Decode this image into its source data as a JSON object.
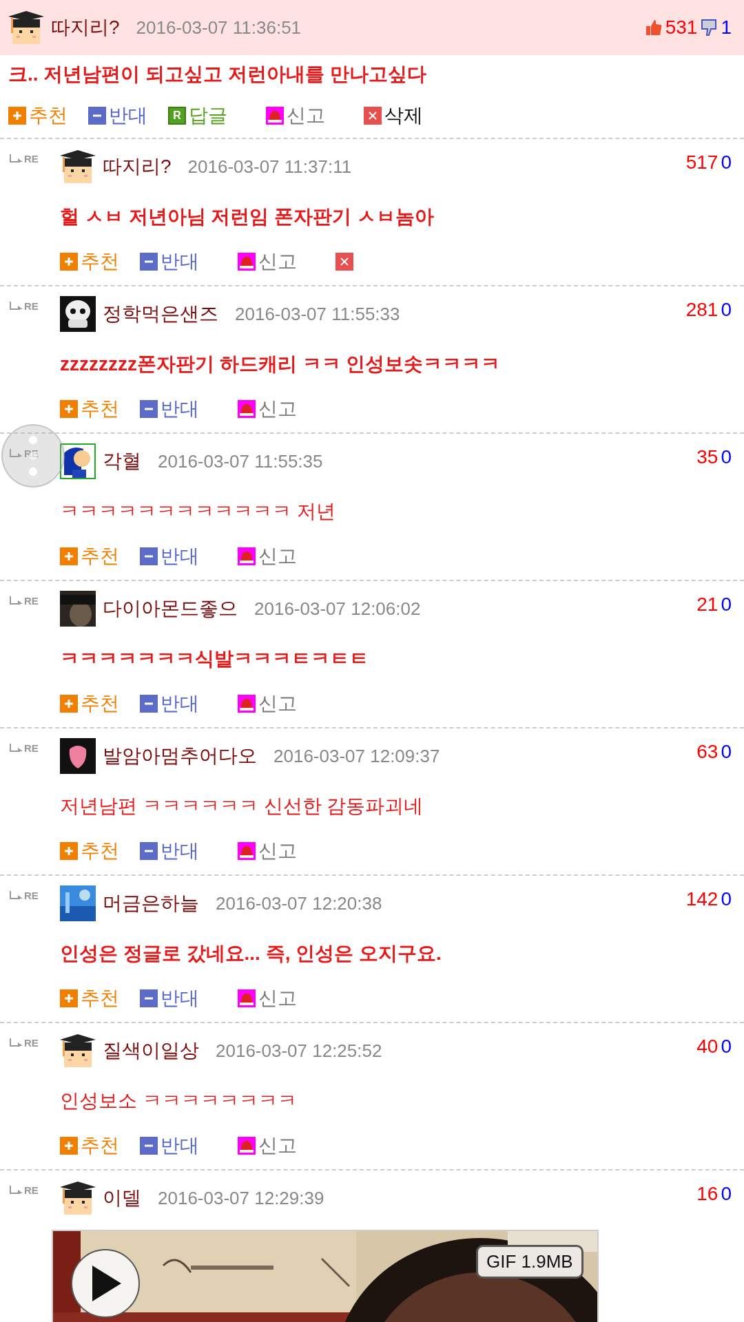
{
  "post": {
    "author": "따지리?",
    "time": "2016-03-07 11:36:51",
    "likes": "531",
    "dislikes": "1",
    "text": "크.. 저년남편이 되고싶고 저런아내를 만나고싶다",
    "bold": true,
    "avatar": {
      "kind": "graduate"
    },
    "actions": [
      {
        "kind": "recommend",
        "label": "추천"
      },
      {
        "kind": "oppose",
        "label": "반대"
      },
      {
        "kind": "reply",
        "icon": "R",
        "label": "답글"
      },
      {
        "kind": "report",
        "label": "신고"
      },
      {
        "kind": "delete",
        "label": "삭제"
      }
    ]
  },
  "replies": [
    {
      "tag": "RE",
      "author": "따지리?",
      "time": "2016-03-07 11:37:11",
      "likes": "517",
      "dislikes": "0",
      "text": "헐 ㅅㅂ 저년아님 저런임 폰자판기 ㅅㅂ놈아",
      "bold": true,
      "avatar": {
        "kind": "graduate"
      },
      "actions": [
        {
          "kind": "recommend",
          "label": "추천"
        },
        {
          "kind": "oppose",
          "label": "반대"
        },
        {
          "kind": "report",
          "label": "신고"
        },
        {
          "kind": "delete"
        }
      ]
    },
    {
      "tag": "RE",
      "author": "정학먹은샌즈",
      "time": "2016-03-07 11:55:33",
      "likes": "281",
      "dislikes": "0",
      "text": "zzzzzzzz폰자판기 하드캐리 ㅋㅋ 인성보솟ㅋㅋㅋㅋ",
      "bold": true,
      "avatar": {
        "kind": "skull"
      },
      "actions": [
        {
          "kind": "recommend",
          "label": "추천"
        },
        {
          "kind": "oppose",
          "label": "반대"
        },
        {
          "kind": "report",
          "label": "신고"
        }
      ]
    },
    {
      "tag": "RE",
      "author": "각혈",
      "time": "2016-03-07 11:55:35",
      "likes": "35",
      "dislikes": "0",
      "text": "ㅋㅋㅋㅋㅋㅋㅋㅋㅋㅋㅋㅋ 저년",
      "bold": false,
      "avatar": {
        "kind": "blue-figure"
      },
      "actions": [
        {
          "kind": "recommend",
          "label": "추천"
        },
        {
          "kind": "oppose",
          "label": "반대"
        },
        {
          "kind": "report",
          "label": "신고"
        }
      ]
    },
    {
      "tag": "RE",
      "author": "다이아몬드좋으",
      "time": "2016-03-07 12:06:02",
      "likes": "21",
      "dislikes": "0",
      "text": "ㅋㅋㅋㅋㅋㅋㅋ식발ㅋㅋㅋㅌㅋㅌㅌ",
      "bold": true,
      "avatar": {
        "kind": "dark"
      },
      "actions": [
        {
          "kind": "recommend",
          "label": "추천"
        },
        {
          "kind": "oppose",
          "label": "반대"
        },
        {
          "kind": "report",
          "label": "신고"
        }
      ]
    },
    {
      "tag": "RE",
      "author": "발암아멈추어다오",
      "time": "2016-03-07 12:09:37",
      "likes": "63",
      "dislikes": "0",
      "text": "저년남편 ㅋㅋㅋㅋㅋㅋ 신선한 감동파괴네",
      "bold": false,
      "avatar": {
        "kind": "pink"
      },
      "actions": [
        {
          "kind": "recommend",
          "label": "추천"
        },
        {
          "kind": "oppose",
          "label": "반대"
        },
        {
          "kind": "report",
          "label": "신고"
        }
      ]
    },
    {
      "tag": "RE",
      "author": "머금은하늘",
      "time": "2016-03-07 12:20:38",
      "likes": "142",
      "dislikes": "0",
      "text": "인성은 정글로 갔네요... 즉, 인성은 오지구요.",
      "bold": true,
      "avatar": {
        "kind": "sky"
      },
      "actions": [
        {
          "kind": "recommend",
          "label": "추천"
        },
        {
          "kind": "oppose",
          "label": "반대"
        },
        {
          "kind": "report",
          "label": "신고"
        }
      ]
    },
    {
      "tag": "RE",
      "author": "질색이일상",
      "time": "2016-03-07 12:25:52",
      "likes": "40",
      "dislikes": "0",
      "text": "인성보소 ㅋㅋㅋㅋㅋㅋㅋㅋ",
      "bold": false,
      "avatar": {
        "kind": "graduate"
      },
      "actions": [
        {
          "kind": "recommend",
          "label": "추천"
        },
        {
          "kind": "oppose",
          "label": "반대"
        },
        {
          "kind": "report",
          "label": "신고"
        }
      ]
    },
    {
      "tag": "RE",
      "author": "이델",
      "time": "2016-03-07 12:29:39",
      "likes": "16",
      "dislikes": "0",
      "avatar": {
        "kind": "graduate"
      },
      "attachment": {
        "kind": "gif",
        "badge": "GIF 1.9MB"
      }
    }
  ]
}
